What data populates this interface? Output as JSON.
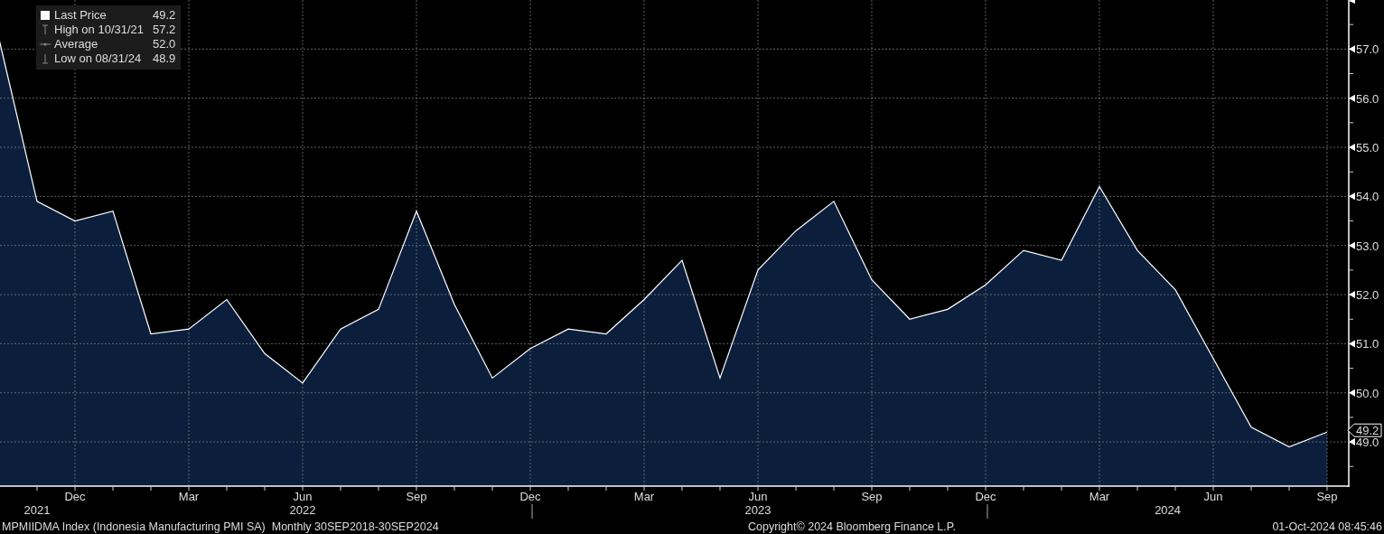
{
  "chart_data": {
    "type": "area",
    "grid": true,
    "categories": [
      null,
      null,
      "Dec",
      null,
      null,
      "Mar",
      null,
      null,
      "Jun",
      null,
      null,
      "Sep",
      null,
      null,
      "Dec",
      null,
      null,
      "Mar",
      null,
      null,
      "Jun",
      null,
      null,
      "Sep",
      null,
      null,
      "Dec",
      null,
      null,
      "Mar",
      null,
      null,
      "Jun",
      null,
      null,
      "Sep"
    ],
    "series": [
      {
        "name": "Last Price",
        "color": "#ffffff",
        "values": [
          57.2,
          53.9,
          53.5,
          53.7,
          51.2,
          51.3,
          51.9,
          50.8,
          50.2,
          51.3,
          51.7,
          53.7,
          51.8,
          50.3,
          50.9,
          51.3,
          51.2,
          51.9,
          52.7,
          50.3,
          52.5,
          53.3,
          53.9,
          52.3,
          51.5,
          51.7,
          52.2,
          52.9,
          52.7,
          54.2,
          52.9,
          52.1,
          50.7,
          49.3,
          48.9,
          49.2
        ]
      }
    ],
    "ylim": [
      48.1,
      58.0
    ],
    "yticks": [
      {
        "value": 49,
        "label": "49.0"
      },
      {
        "value": 50,
        "label": "50.0"
      },
      {
        "value": 51,
        "label": "51.0"
      },
      {
        "value": 52,
        "label": "52.0"
      },
      {
        "value": 53,
        "label": "53.0"
      },
      {
        "value": 54,
        "label": "54.0"
      },
      {
        "value": 55,
        "label": "55.0"
      },
      {
        "value": 56,
        "label": "56.0"
      },
      {
        "value": 57,
        "label": "57.0"
      }
    ],
    "annotations": [
      "2021",
      "2022",
      "2023",
      "2024"
    ]
  },
  "last_value_tag": "49.2",
  "legend": [
    {
      "kind": "last",
      "value": "49.2"
    },
    {
      "kind": "high",
      "label": "High on 10/31/21",
      "value": "57.2"
    },
    {
      "kind": "average",
      "label": "Average",
      "value": "52.0"
    },
    {
      "kind": "low",
      "label": "Low on 08/31/24",
      "value": "48.9"
    }
  ],
  "footer": {
    "description": "MPMIIDMA Index (Indonesia Manufacturing PMI SA)  Monthly 30SEP2018-30SEP2024",
    "copyright": "Copyright© 2024 Bloomberg Finance L.P.",
    "timestamp": "01-Oct-2024 08:45:46"
  }
}
